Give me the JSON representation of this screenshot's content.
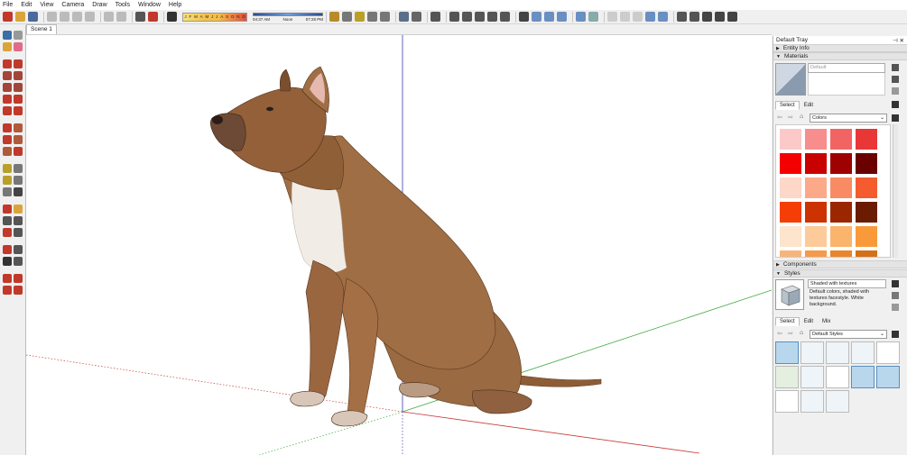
{
  "menu": [
    "File",
    "Edit",
    "View",
    "Camera",
    "Draw",
    "Tools",
    "Window",
    "Help"
  ],
  "toolbar": {
    "months": [
      "J",
      "F",
      "M",
      "A",
      "M",
      "J",
      "J",
      "A",
      "S",
      "O",
      "N",
      "D"
    ],
    "time_start": "04:37 AM",
    "time_mid": "Noon",
    "time_end": "07:28 PM"
  },
  "scene": {
    "tab_label": "Scene 1"
  },
  "tray": {
    "title": "Default Tray",
    "entity_info": "Entity Info",
    "materials": {
      "header": "Materials",
      "name": "Default",
      "tab_select": "Select",
      "tab_edit": "Edit",
      "library": "Colors",
      "swatches": [
        "#fcc9c9",
        "#f88d8d",
        "#f26464",
        "#e93737",
        "#f50000",
        "#c90000",
        "#9f0000",
        "#6a0000",
        "#fdd7c7",
        "#fca98a",
        "#f98b64",
        "#f45c2f",
        "#f43e06",
        "#cc3300",
        "#9a2700",
        "#6b1c00",
        "#fde4cc",
        "#fdca9a",
        "#fbb46c",
        "#f99a3a",
        "#f7b57c",
        "#f59a4a",
        "#e8852a",
        "#d47015"
      ]
    },
    "components": "Components",
    "styles": {
      "header": "Styles",
      "name": "Shaded with textures",
      "description": "Default colors, shaded with textures facestyle. White background.",
      "tab_select": "Select",
      "tab_edit": "Edit",
      "tab_mix": "Mix",
      "library": "Default Styles"
    }
  },
  "colors": {
    "accent": "#5a8fbf",
    "axis_green": "#3fa83f",
    "axis_red": "#c83a3a",
    "axis_blue": "#3a3aa8"
  }
}
